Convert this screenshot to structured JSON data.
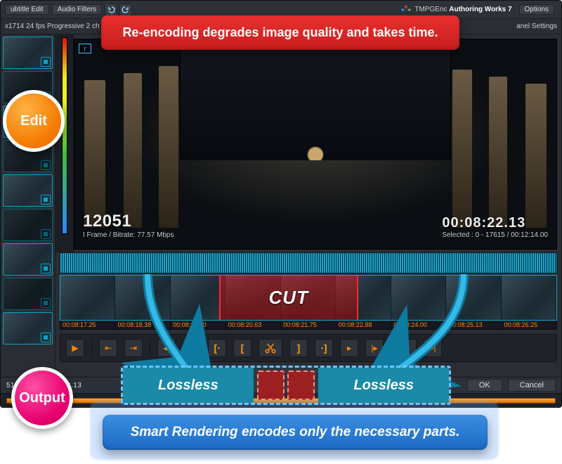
{
  "brand": {
    "name": "TMPGEnc",
    "product": "Authoring Works 7"
  },
  "toolbar": {
    "subtitle_edit": "ubtitle Edit",
    "audio_filters": "Audio Filters",
    "options": "Options",
    "panel_settings": "anel Settings"
  },
  "ribbon": {
    "specs": "x1714 24 fps Progressive  2 ch"
  },
  "viewer": {
    "probe": "r",
    "frame_num": "12051",
    "frame_info": "I Frame    / Bitrate: 77.57 Mbps",
    "timecode": "00:08:22.13",
    "selection": "Selected : 0 - 17615 / 00:12:14.00"
  },
  "timeline": {
    "cut_label": "CUT",
    "timecodes": [
      "00:08:17.25",
      "00:08:18.38",
      "00:08:19.50",
      "00:08:20.63",
      "00:08:21.75",
      "00:08:22.88",
      "00:08:24.00",
      "00:08:25.13",
      "00:08:26.25"
    ]
  },
  "status": {
    "position": "51/17615  00:08:22.13",
    "ok": "OK",
    "cancel": "Cancel"
  },
  "ann": {
    "red": "Re-encoding degrades image quality and takes time.",
    "edit": "Edit",
    "output": "Output",
    "lossless": "Lossless",
    "blue": "Smart Rendering encodes only the necessary parts."
  }
}
